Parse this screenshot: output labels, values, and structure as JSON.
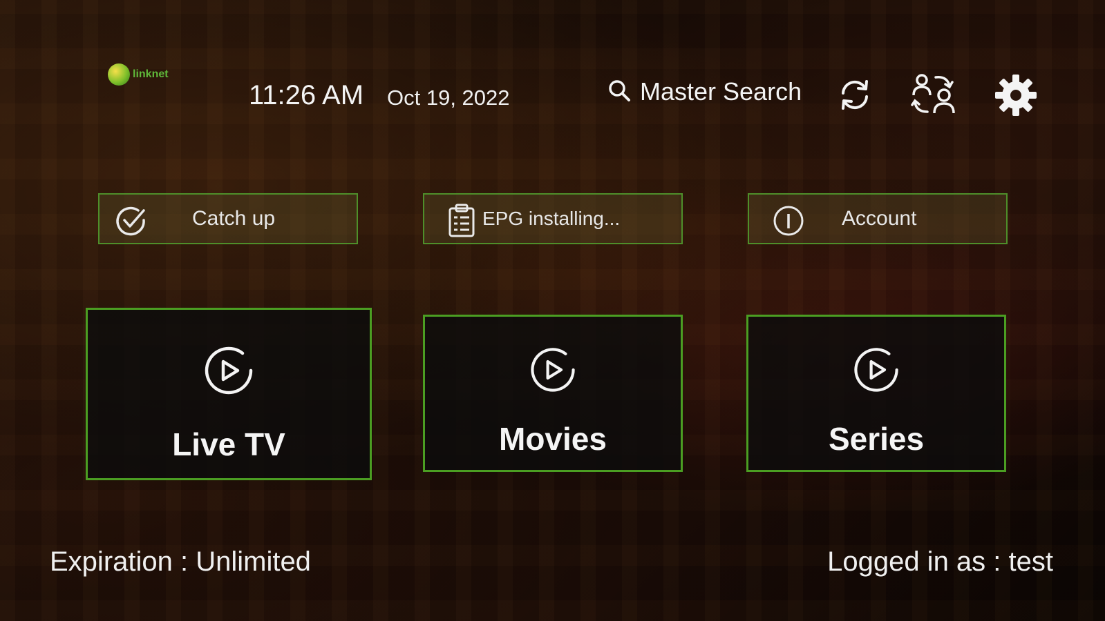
{
  "header": {
    "logo_text": "linknet",
    "time": "11:26 AM",
    "date": "Oct 19, 2022",
    "search_label": "Master Search",
    "icons": [
      "search-icon",
      "refresh-icon",
      "switch-user-icon",
      "settings-gear-icon"
    ]
  },
  "quick_actions": [
    {
      "label": "Catch up",
      "icon": "check-circle-icon"
    },
    {
      "label": "EPG installing...",
      "icon": "clipboard-list-icon"
    },
    {
      "label": "Account",
      "icon": "info-circle-icon"
    }
  ],
  "tiles": [
    {
      "label": "Live TV",
      "icon": "play-circle-icon"
    },
    {
      "label": "Movies",
      "icon": "play-circle-icon"
    },
    {
      "label": "Series",
      "icon": "play-circle-icon"
    }
  ],
  "footer": {
    "expiration": "Expiration : Unlimited",
    "logged_in": "Logged in as : test"
  },
  "colors": {
    "accent_border": "#4b9e22",
    "text": "#f4f4f4"
  }
}
